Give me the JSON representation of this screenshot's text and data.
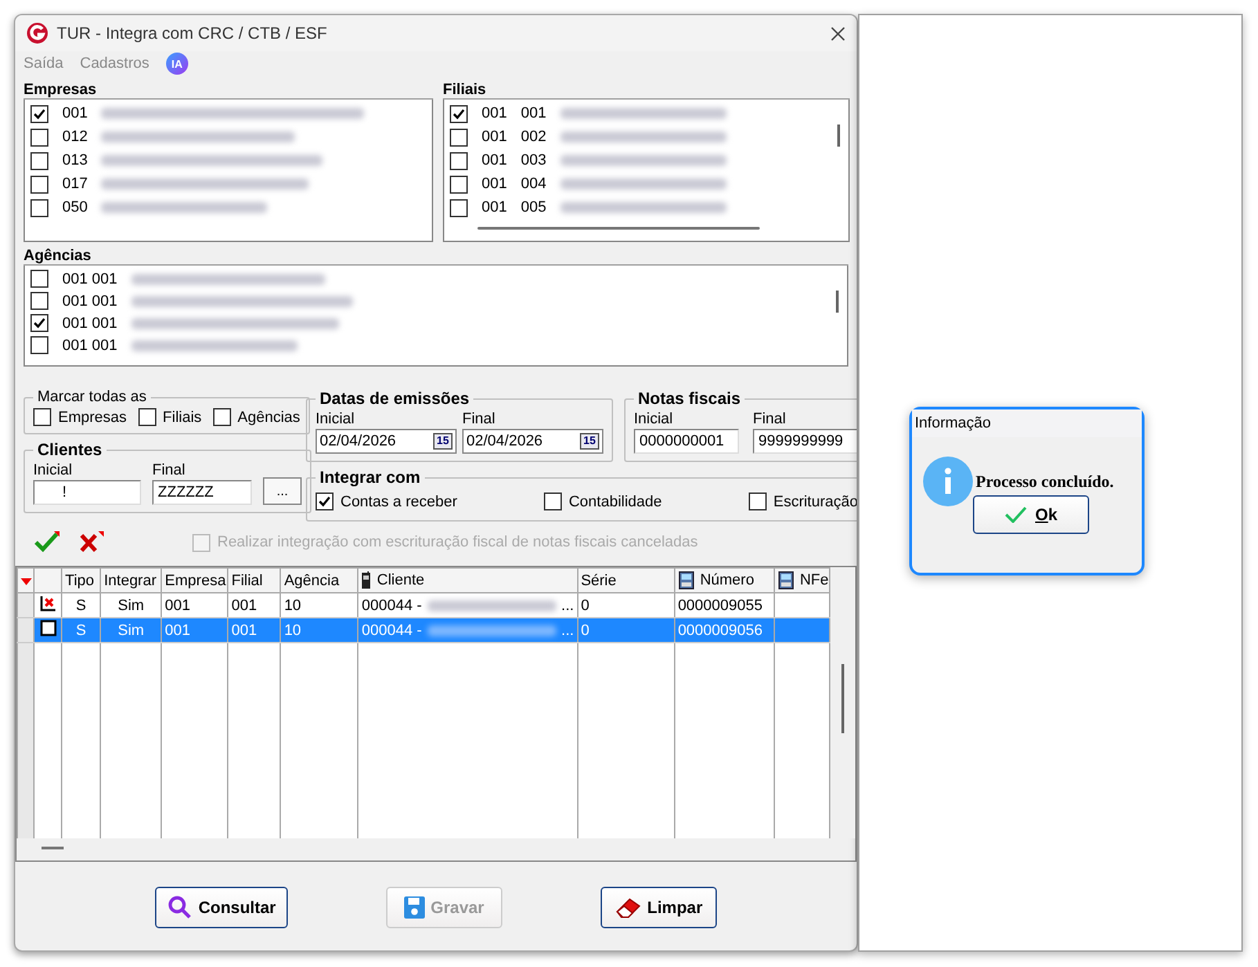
{
  "window": {
    "title": "TUR - Integra com CRC / CTB / ESF"
  },
  "menu": [
    {
      "label": "Saída"
    },
    {
      "label": "Cadastros"
    },
    {
      "label": "IA",
      "kind": "badge"
    }
  ],
  "empresas": {
    "title": "Empresas",
    "items": [
      {
        "code": "001",
        "checked": true
      },
      {
        "code": "012",
        "checked": false
      },
      {
        "code": "013",
        "checked": false
      },
      {
        "code": "017",
        "checked": false
      },
      {
        "code": "050",
        "checked": false
      }
    ]
  },
  "filiais": {
    "title": "Filiais",
    "items": [
      {
        "code": "001",
        "filial": "001",
        "checked": true
      },
      {
        "code": "001",
        "filial": "002",
        "checked": false
      },
      {
        "code": "001",
        "filial": "003",
        "checked": false
      },
      {
        "code": "001",
        "filial": "004",
        "checked": false
      },
      {
        "code": "001",
        "filial": "005",
        "checked": false
      }
    ]
  },
  "agencias": {
    "title": "Agências",
    "items": [
      {
        "code": "001 001",
        "checked": false
      },
      {
        "code": "001 001",
        "checked": false
      },
      {
        "code": "001 001",
        "checked": true
      },
      {
        "code": "001 001",
        "checked": false
      }
    ]
  },
  "marcar_todas": {
    "title": "Marcar todas as",
    "options": [
      {
        "label": "Empresas",
        "checked": false
      },
      {
        "label": "Filiais",
        "checked": false
      },
      {
        "label": "Agências",
        "checked": false
      }
    ]
  },
  "clientes": {
    "title": "Clientes",
    "inicial_label": "Inicial",
    "inicial_value": "!",
    "final_label": "Final",
    "final_value": "ZZZZZZ",
    "browse": "..."
  },
  "datas": {
    "title": "Datas de emissões",
    "inicial_label": "Inicial",
    "inicial_value": "02/04/2026",
    "final_label": "Final",
    "final_value": "02/04/2026",
    "inicial_calendar": "15",
    "final_calendar": "15"
  },
  "notas": {
    "title": "Notas fiscais",
    "inicial_label": "Inicial",
    "inicial_value": "0000000001",
    "final_label": "Final",
    "final_value": "9999999999"
  },
  "integrar_com": {
    "title": "Integrar com",
    "options": [
      {
        "label": "Contas a receber",
        "checked": true
      },
      {
        "label": "Contabilidade",
        "checked": false
      },
      {
        "label": "Escrituração",
        "checked": false
      }
    ]
  },
  "cancel_option": {
    "label": "Realizar integração com escrituração fiscal de notas fiscais canceladas",
    "checked": false,
    "disabled": true
  },
  "table": {
    "columns": [
      {
        "label": "Tipo"
      },
      {
        "label": "Integrar"
      },
      {
        "label": "Empresa"
      },
      {
        "label": "Filial"
      },
      {
        "label": "Agência"
      },
      {
        "label": "Cliente",
        "kind": "phone"
      },
      {
        "label": "Série"
      },
      {
        "label": "Número",
        "kind": "device"
      },
      {
        "label": "NFe",
        "kind": "device"
      }
    ],
    "rows": [
      {
        "kind": "error",
        "selected": false,
        "cells": [
          "S",
          "Sim",
          "001",
          "001",
          "10",
          "000044 -",
          "0",
          "0000009055",
          ""
        ],
        "cliente_tail": "..."
      },
      {
        "kind": "plain",
        "selected": true,
        "cells": [
          "S",
          "Sim",
          "001",
          "001",
          "10",
          "000044 -",
          "0",
          "0000009056",
          ""
        ],
        "cliente_tail": "..."
      }
    ]
  },
  "buttons": [
    {
      "label": "Consultar",
      "kind": "search",
      "disabled": false
    },
    {
      "label": "Gravar",
      "kind": "save",
      "disabled": true
    },
    {
      "label": "Limpar",
      "kind": "eraser",
      "disabled": false
    }
  ],
  "dialog": {
    "title": "Informação",
    "message": "Processo concluído.",
    "button": "Ok"
  }
}
